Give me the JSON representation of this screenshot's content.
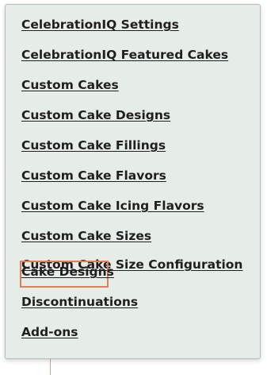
{
  "background": {
    "fragment_text": "...o.... ..... ..."
  },
  "menu": {
    "items": [
      {
        "label": "CelebrationIQ Settings"
      },
      {
        "label": "CelebrationIQ Featured Cakes"
      },
      {
        "label": "Custom Cakes"
      },
      {
        "label": "Custom Cake Designs"
      },
      {
        "label": "Custom Cake Fillings"
      },
      {
        "label": "Custom Cake Flavors"
      },
      {
        "label": "Custom Cake Icing Flavors"
      },
      {
        "label": "Custom Cake Sizes"
      },
      {
        "label": "Custom Cake Size Configuration"
      },
      {
        "label": "Cake Designs"
      },
      {
        "label": "Discontinuations"
      },
      {
        "label": "Add-ons"
      }
    ],
    "highlighted_item": "Cake Designs",
    "highlight_color": "#e07d5a"
  }
}
